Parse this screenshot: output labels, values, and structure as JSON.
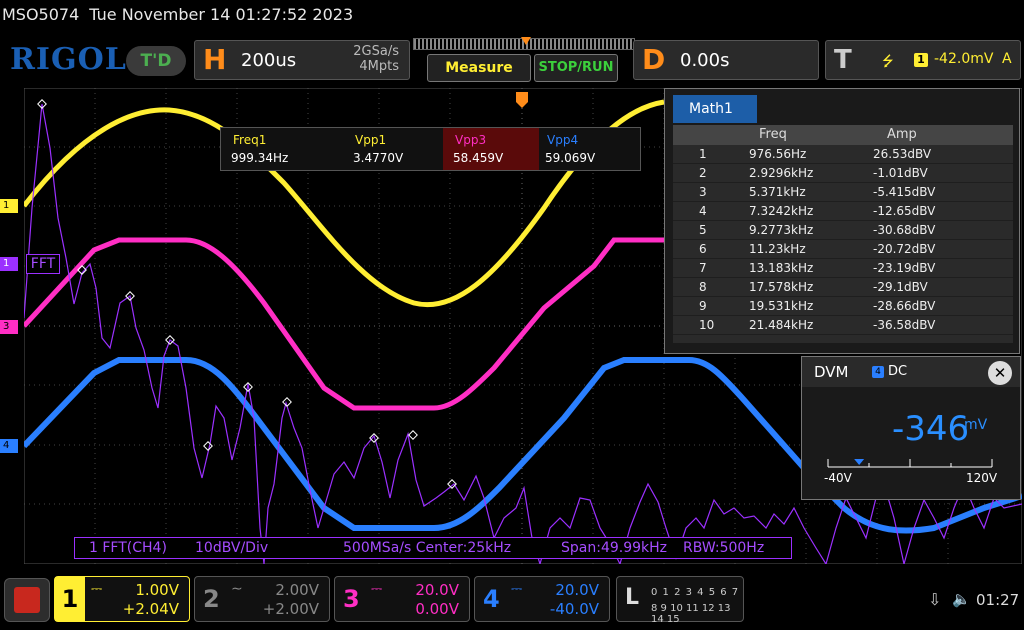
{
  "title": {
    "model": "MSO5074",
    "datetime": "Tue November 14 01:27:52 2023"
  },
  "logo": "RIGOL",
  "trig_status": "T'D",
  "horizontal": {
    "letter": "H",
    "timebase": "200us",
    "sample_rate": "2GSa/s",
    "memory_depth": "4Mpts"
  },
  "buttons": {
    "measure": "Measure",
    "stop_run": "STOP/RUN"
  },
  "delay": {
    "letter": "D",
    "value": "0.00s"
  },
  "trigger": {
    "letter": "T",
    "source": "1",
    "level": "-42.0mV",
    "mode": "A"
  },
  "channel_markers": [
    {
      "label": "1",
      "color": "#ffee33"
    },
    {
      "label": "1",
      "color": "#9b30ff"
    },
    {
      "label": "3",
      "color": "#ff2ec4"
    },
    {
      "label": "4",
      "color": "#2a7fff"
    }
  ],
  "fft_label": "FFT",
  "measurements": [
    {
      "label": "Freq1",
      "value": "999.34Hz",
      "color": "#ffee33"
    },
    {
      "label": "Vpp1",
      "value": "3.4770V",
      "color": "#ffee33"
    },
    {
      "label": "Vpp3",
      "value": "58.459V",
      "color": "#ff2ec4"
    },
    {
      "label": "Vpp4",
      "value": "59.069V",
      "color": "#2a7fff"
    }
  ],
  "math_panel": {
    "title": "Math1",
    "col_freq": "Freq",
    "col_amp": "Amp",
    "rows": [
      {
        "i": "1",
        "freq": "976.56Hz",
        "amp": "26.53dBV"
      },
      {
        "i": "2",
        "freq": "2.9296kHz",
        "amp": "-1.01dBV"
      },
      {
        "i": "3",
        "freq": "5.371kHz",
        "amp": "-5.415dBV"
      },
      {
        "i": "4",
        "freq": "7.3242kHz",
        "amp": "-12.65dBV"
      },
      {
        "i": "5",
        "freq": "9.2773kHz",
        "amp": "-30.68dBV"
      },
      {
        "i": "6",
        "freq": "11.23kHz",
        "amp": "-20.72dBV"
      },
      {
        "i": "7",
        "freq": "13.183kHz",
        "amp": "-23.19dBV"
      },
      {
        "i": "8",
        "freq": "17.578kHz",
        "amp": "-29.1dBV"
      },
      {
        "i": "9",
        "freq": "19.531kHz",
        "amp": "-28.66dBV"
      },
      {
        "i": "10",
        "freq": "21.484kHz",
        "amp": "-36.58dBV"
      }
    ]
  },
  "dvm": {
    "title": "DVM",
    "channel": "4",
    "mode": "DC",
    "value": "-346",
    "unit": "mV",
    "range_min": "-40V",
    "range_max": "120V",
    "level": 0.19
  },
  "fft_info": {
    "source": "1 FFT(CH4)",
    "scale": "10dBV/Div",
    "rate_center": "500MSa/s Center:25kHz",
    "span": "Span:49.99kHz",
    "rbw": "RBW:500Hz"
  },
  "channels": [
    {
      "num": "1",
      "coupling": "⎓",
      "scale": "1.00V",
      "offset": "+2.04V",
      "color": "#ffee33",
      "active": true
    },
    {
      "num": "2",
      "coupling": "∼",
      "scale": "2.00V",
      "offset": "+2.00V",
      "color": "#888888",
      "active": false
    },
    {
      "num": "3",
      "coupling": "⎓",
      "scale": "20.0V",
      "offset": "0.00V",
      "color": "#ff2ec4",
      "active": true
    },
    {
      "num": "4",
      "coupling": "⎓",
      "scale": "20.0V",
      "offset": "-40.0V",
      "color": "#2a7fff",
      "active": true
    }
  ],
  "logic": {
    "letter": "L",
    "row1": "0 1 2 3   4 5 6 7",
    "row2": "8 9 10 11  12 13 14 15"
  },
  "status": {
    "usb": "⇩",
    "speaker": "🔈",
    "time": "01:27"
  }
}
